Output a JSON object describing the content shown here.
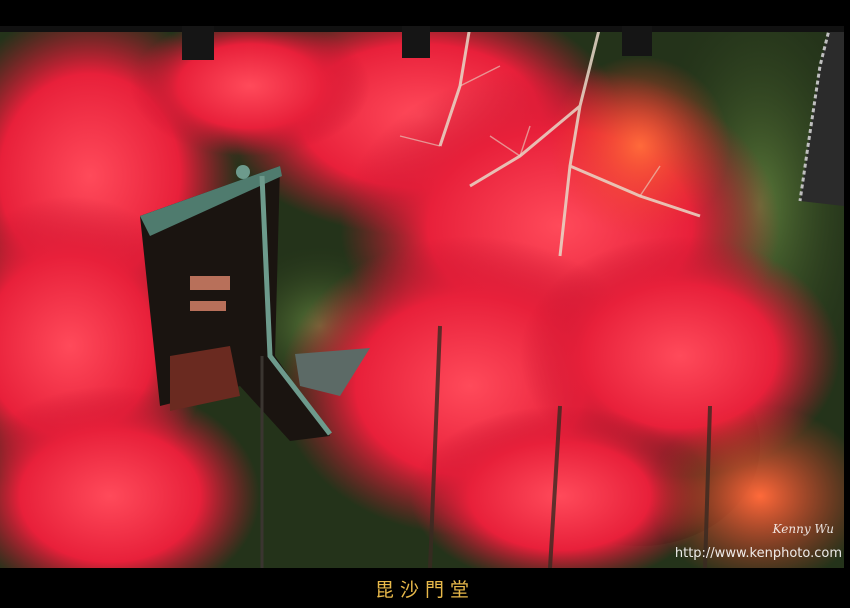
{
  "photo": {
    "caption": "毘沙門堂",
    "signature": "Kenny Wu",
    "url": "http://www.kenphoto.com"
  }
}
